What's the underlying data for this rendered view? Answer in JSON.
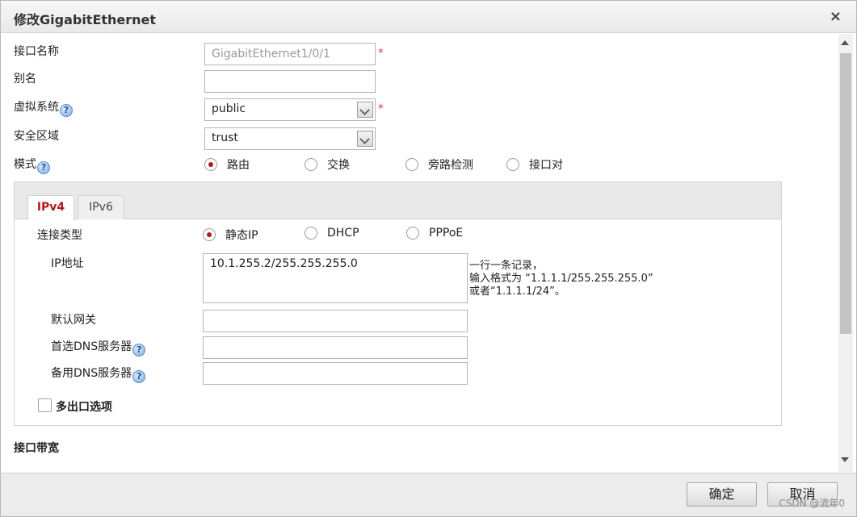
{
  "dialog": {
    "title": "修改GigabitEthernet",
    "close_glyph": "×"
  },
  "form": {
    "interface_name_label": "接口名称",
    "interface_name_value": "GigabitEthernet1/0/1",
    "required_mark": "*",
    "alias_label": "别名",
    "alias_value": "",
    "vsys_label": "虚拟系统",
    "vsys_value": "public",
    "zone_label": "安全区域",
    "zone_value": "trust",
    "mode_label": "模式",
    "mode_options": [
      "路由",
      "交换",
      "旁路检测",
      "接口对"
    ],
    "mode_selected": "路由",
    "help_glyph": "?"
  },
  "ip_panel": {
    "tabs": [
      "IPv4",
      "IPv6"
    ],
    "active_tab": "IPv4",
    "conn_type_label": "连接类型",
    "conn_options": [
      "静态IP",
      "DHCP",
      "PPPoE"
    ],
    "conn_selected": "静态IP",
    "ip_label": "IP地址",
    "ip_value": "10.1.255.2/255.255.255.0",
    "ip_hint_line1": "一行一条记录，",
    "ip_hint_line2": "输入格式为 “1.1.1.1/255.255.255.0”",
    "ip_hint_line3": "或者“1.1.1.1/24”。",
    "gateway_label": "默认网关",
    "gateway_value": "",
    "dns1_label": "首选DNS服务器",
    "dns1_value": "",
    "dns2_label": "备用DNS服务器",
    "dns2_value": "",
    "multi_exit_label": "多出口选项"
  },
  "bandwidth": {
    "label": "接口带宽"
  },
  "footer": {
    "ok_label": "确定",
    "cancel_label": "取消",
    "watermark": "CSDN @流年0"
  },
  "colors": {
    "accent_red": "#b01b1b",
    "required_red": "#e23b3b"
  }
}
